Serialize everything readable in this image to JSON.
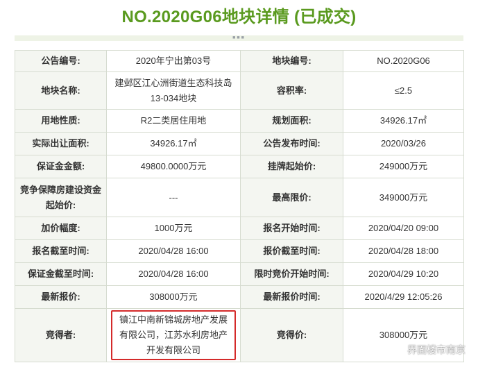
{
  "title": "NO.2020G06地块详情 (已成交)",
  "table": {
    "rows": [
      [
        {
          "k": "公告编号:",
          "v": "2020年宁出第03号"
        },
        {
          "k": "地块编号:",
          "v": "NO.2020G06"
        }
      ],
      [
        {
          "k": "地块名称:",
          "v": "建邺区江心洲街道生态科技岛13-034地块"
        },
        {
          "k": "容积率:",
          "v": "≤2.5"
        }
      ],
      [
        {
          "k": "用地性质:",
          "v": "R2二类居住用地"
        },
        {
          "k": "规划面积:",
          "v": "34926.17㎡"
        }
      ],
      [
        {
          "k": "实际出让面积:",
          "v": "34926.17㎡"
        },
        {
          "k": "公告发布时间:",
          "v": "2020/03/26"
        }
      ],
      [
        {
          "k": "保证金金额:",
          "v": "49800.0000万元"
        },
        {
          "k": "挂牌起始价:",
          "v": "249000万元"
        }
      ],
      [
        {
          "k": "竞争保障房建设资金起始价:",
          "v": "---"
        },
        {
          "k": "最高限价:",
          "v": "349000万元"
        }
      ],
      [
        {
          "k": "加价幅度:",
          "v": "1000万元"
        },
        {
          "k": "报名开始时间:",
          "v": "2020/04/20 09:00"
        }
      ],
      [
        {
          "k": "报名截至时间:",
          "v": "2020/04/28 16:00"
        },
        {
          "k": "报价截至时间:",
          "v": "2020/04/28 18:00"
        }
      ],
      [
        {
          "k": "保证金截至时间:",
          "v": "2020/04/28 16:00"
        },
        {
          "k": "限时竞价开始时间:",
          "v": "2020/04/29 10:20"
        }
      ],
      [
        {
          "k": "最新报价:",
          "v": "308000万元"
        },
        {
          "k": "最新报价时间:",
          "v": "2020/4/29 12:05:26"
        }
      ],
      [
        {
          "k": "竞得者:",
          "v": "镇江中南新锦城房地产发展有限公司，江苏水利房地产开发有限公司"
        },
        {
          "k": "竞得价:",
          "v": "308000万元"
        }
      ]
    ]
  },
  "watermark": "界面楼市南京",
  "colors": {
    "title_green": "#5a9a1f",
    "price_green": "#4a9a1e",
    "price_red": "#e02020",
    "highlight_border": "#d42a2a"
  }
}
